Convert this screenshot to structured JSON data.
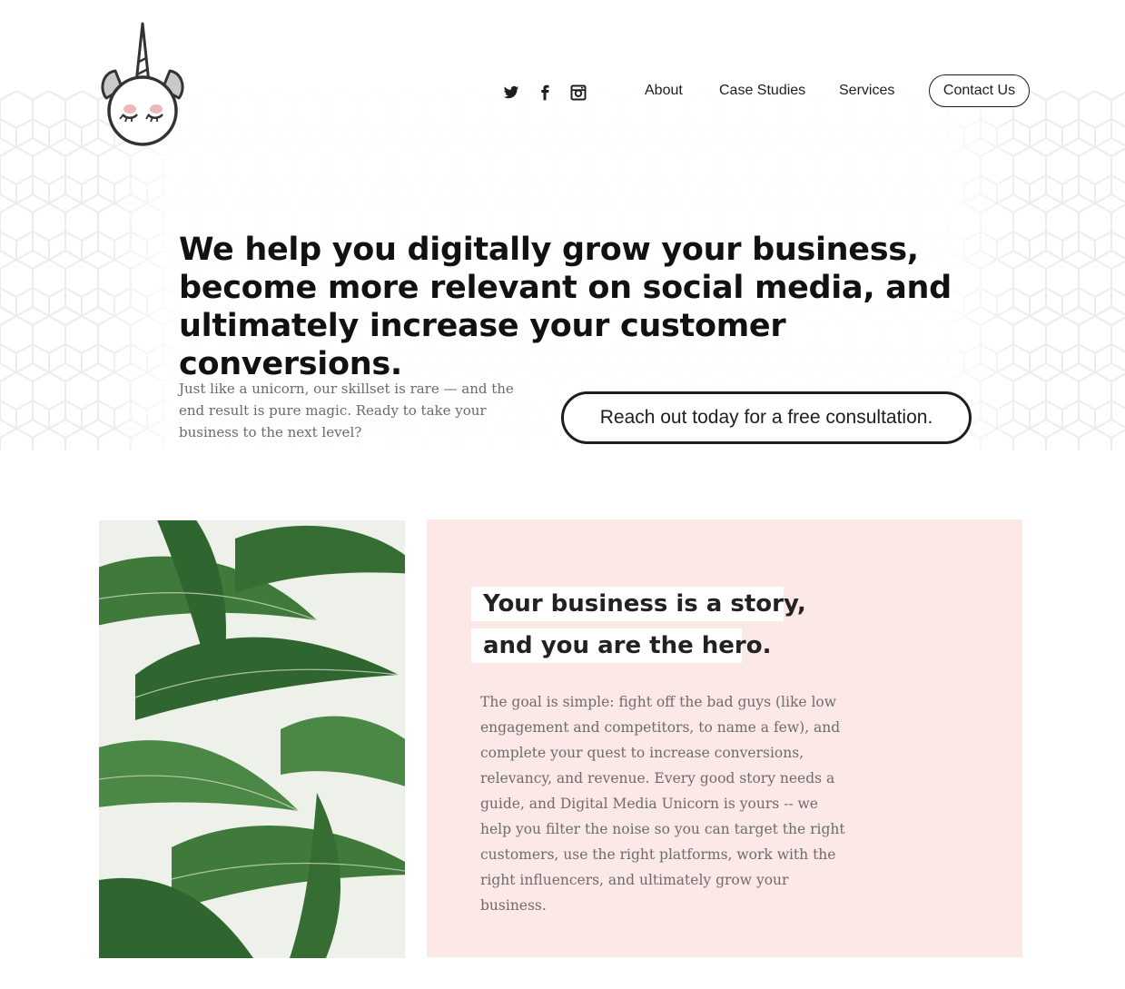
{
  "header": {
    "logo_icon": "unicorn-logo-icon",
    "social": [
      {
        "name": "twitter-icon"
      },
      {
        "name": "facebook-icon"
      },
      {
        "name": "instagram-icon"
      }
    ],
    "nav": {
      "about": "About",
      "case_studies": "Case Studies",
      "services": "Services",
      "contact": "Contact Us"
    }
  },
  "hero": {
    "headline": "We help you digitally grow your business, become more relevant on social media, and ultimately increase your customer conversions.",
    "subtext": "Just like a unicorn, our skillset is rare — and the end result is pure magic. Ready to take your business to the next level?",
    "cta_label": "Reach out today for a free consultation."
  },
  "story": {
    "heading_line1": "Your business is a story,",
    "heading_line2": "and you are the hero.",
    "body": "The goal is simple: fight off the bad guys (like low engagement and competitors, to name a few), and complete your quest to increase conversions, relevancy, and revenue. Every good story needs a guide, and Digital Media Unicorn is yours -- we help you filter the noise so you can target the right customers, use the right platforms, work with the right influencers, and ultimately grow your business."
  },
  "colors": {
    "accent_pink": "#fde8e8",
    "text_dark": "#1e1e1e",
    "text_muted": "#6a6a6a",
    "leaf_green": "#3f7a3a"
  }
}
